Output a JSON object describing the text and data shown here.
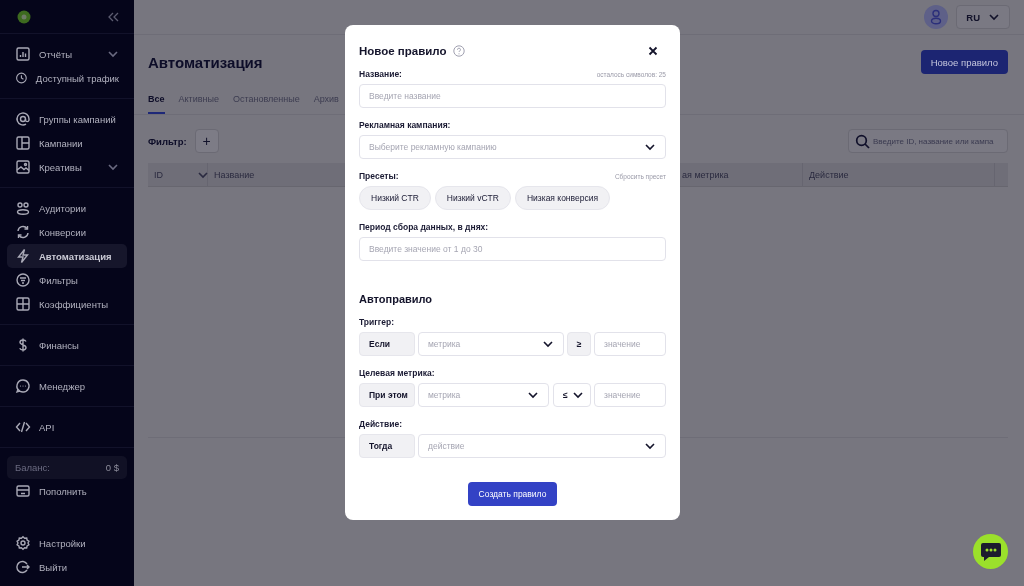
{
  "sidebar": {
    "groups": [
      [
        {
          "label": "Отчёты",
          "expandable": true,
          "selected": false
        },
        {
          "label": "Доступный трафик",
          "expandable": false,
          "selected": false
        }
      ],
      [
        {
          "label": "Группы кампаний",
          "expandable": false,
          "selected": false
        },
        {
          "label": "Кампании",
          "expandable": false,
          "selected": false
        },
        {
          "label": "Креативы",
          "expandable": true,
          "selected": false
        }
      ],
      [
        {
          "label": "Аудитории",
          "expandable": false,
          "selected": false
        },
        {
          "label": "Конверсии",
          "expandable": false,
          "selected": false
        },
        {
          "label": "Автоматизация",
          "expandable": false,
          "selected": true
        },
        {
          "label": "Фильтры",
          "expandable": false,
          "selected": false
        },
        {
          "label": "Коэффициенты",
          "expandable": false,
          "selected": false
        }
      ],
      [
        {
          "label": "Финансы",
          "expandable": false,
          "selected": false
        }
      ],
      [
        {
          "label": "Менеджер",
          "expandable": false,
          "selected": false
        }
      ],
      [
        {
          "label": "API",
          "expandable": false,
          "selected": false
        }
      ]
    ],
    "balance": {
      "label": "Баланс:",
      "value": "0 $"
    },
    "topup": "Пополнить",
    "bottom_items": [
      "Настройки",
      "Выйти"
    ]
  },
  "header": {
    "language": "RU"
  },
  "page": {
    "title": "Автоматизация",
    "new_button": "Новое правило",
    "tabs": [
      {
        "label": "Все",
        "selected": true
      },
      {
        "label": "Активные",
        "selected": false
      },
      {
        "label": "Остановленные",
        "selected": false
      },
      {
        "label": "Архив",
        "selected": false
      }
    ],
    "filter_label": "Фильтр:",
    "add_filter": "+",
    "search": {
      "placeholder": "Введите ID, название или кампа"
    },
    "table": {
      "columns": [
        {
          "label": "ID",
          "sortable": true
        },
        {
          "label": "Название",
          "sortable": false
        },
        {
          "label": "ая метрика",
          "sortable": false
        },
        {
          "label": "Действие",
          "sortable": false
        }
      ]
    }
  },
  "modal": {
    "title": "Новое правило",
    "name": {
      "label": "Название:",
      "counter": "осталось символов: 25",
      "placeholder": "Введите название"
    },
    "campaign": {
      "label": "Рекламная кампания:",
      "placeholder": "Выберите рекламную кампанию"
    },
    "presets": {
      "label": "Пресеты:",
      "reset": "Сбросить пресет",
      "items": [
        "Низкий CTR",
        "Низкий vCTR",
        "Низкая конверсия"
      ]
    },
    "period": {
      "label": "Период сбора данных, в днях:",
      "placeholder": "Введите значение от 1 до 30"
    },
    "autorule": {
      "title": "Автоправило",
      "rows": [
        {
          "kind": "condition",
          "label": "Триггер:",
          "prefix": "Если",
          "metric": "метрика",
          "operator": "≥",
          "operator_dropdown": false,
          "placeholder": "значение"
        },
        {
          "kind": "condition",
          "label": "Целевая метрика:",
          "prefix": "При этом",
          "metric": "метрика",
          "operator": "≤",
          "operator_dropdown": true,
          "placeholder": "значение"
        },
        {
          "kind": "action",
          "label": "Действие:",
          "prefix": "Тогда",
          "action": "действие"
        }
      ]
    },
    "submit": "Создать правило"
  }
}
